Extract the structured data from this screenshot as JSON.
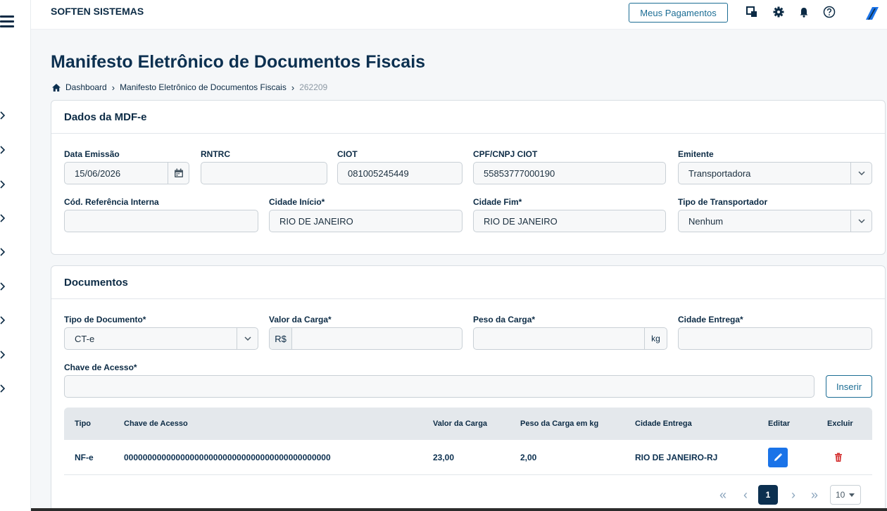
{
  "topbar": {
    "brand": "SOFTEN SISTEMAS",
    "payments_button": "Meus Pagamentos",
    "icons": [
      "windows-icon",
      "gear-icon",
      "bell-icon",
      "help-icon",
      "logo-icon"
    ]
  },
  "page": {
    "title": "Manifesto Eletrônico de Documentos Fiscais",
    "breadcrumb": {
      "home_icon": "home-icon",
      "items": [
        "Dashboard",
        "Manifesto Eletrônico de Documentos Fiscais",
        "262209"
      ]
    }
  },
  "mdfe": {
    "title": "Dados da MDF-e",
    "fields": {
      "data_emissao": {
        "label": "Data Emissão",
        "value": "15/06/2026",
        "icon": "calendar-icon"
      },
      "rntrc": {
        "label": "RNTRC",
        "value": ""
      },
      "ciot": {
        "label": "CIOT",
        "value": "081005245449"
      },
      "cpf_cnpj_ciot": {
        "label": "CPF/CNPJ CIOT",
        "value": "55853777000190"
      },
      "emitente": {
        "label": "Emitente",
        "value": "Transportadora"
      },
      "cod_ref": {
        "label": "Cód. Referência Interna",
        "value": ""
      },
      "cidade_inicio": {
        "label": "Cidade Início*",
        "value": "RIO DE JANEIRO"
      },
      "cidade_fim": {
        "label": "Cidade Fim*",
        "value": "RIO DE JANEIRO"
      },
      "tipo_transportador": {
        "label": "Tipo de Transportador",
        "value": "Nenhum"
      }
    }
  },
  "documentos": {
    "title": "Documentos",
    "fields": {
      "tipo_documento": {
        "label": "Tipo de Documento*",
        "value": "CT-e"
      },
      "valor_carga": {
        "label": "Valor da Carga*",
        "prefix": "R$",
        "value": ""
      },
      "peso_carga": {
        "label": "Peso da Carga*",
        "suffix": "kg",
        "value": ""
      },
      "cidade_entrega": {
        "label": "Cidade Entrega*",
        "value": ""
      },
      "chave_acesso": {
        "label": "Chave de Acesso*",
        "value": ""
      }
    },
    "insert_button": "Inserir",
    "table": {
      "columns": [
        "Tipo",
        "Chave de Acesso",
        "Valor da Carga",
        "Peso da Carga em kg",
        "Cidade Entrega",
        "Editar",
        "Excluir"
      ],
      "rows": [
        {
          "tipo": "NF-e",
          "chave": "00000000000000000000000000000000000000000000",
          "valor": "23,00",
          "peso": "2,00",
          "cidade": "RIO DE JANEIRO-RJ"
        }
      ]
    },
    "pagination": {
      "current_page": "1",
      "page_size": "10"
    }
  },
  "colors": {
    "primary": "#0c3050",
    "accent_blue": "#1a73e8",
    "danger": "#d32f2f",
    "outline": "#1c6d94"
  }
}
